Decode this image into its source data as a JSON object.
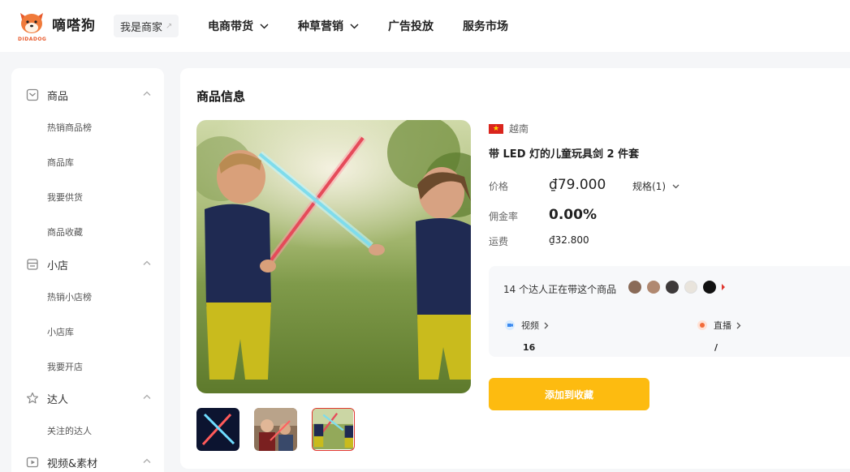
{
  "brand": {
    "name": "嘀嗒狗",
    "sub": "DIDADOG",
    "icon": "dog-logo-icon"
  },
  "merchant_switch": {
    "label": "我是商家",
    "icon": "arrow-up-right-icon"
  },
  "nav": [
    {
      "label": "电商带货",
      "has_dropdown": true
    },
    {
      "label": "种草营销",
      "has_dropdown": true
    },
    {
      "label": "广告投放",
      "has_dropdown": false
    },
    {
      "label": "服务市场",
      "has_dropdown": false
    }
  ],
  "sidebar": {
    "groups": [
      {
        "label": "商品",
        "icon": "product-icon",
        "expanded": true,
        "items": [
          "热销商品榜",
          "商品库",
          "我要供货",
          "商品收藏"
        ]
      },
      {
        "label": "小店",
        "icon": "shop-icon",
        "expanded": true,
        "items": [
          "热销小店榜",
          "小店库",
          "我要开店"
        ]
      },
      {
        "label": "达人",
        "icon": "star-person-icon",
        "expanded": true,
        "items": [
          "关注的达人"
        ]
      },
      {
        "label": "视频&素材",
        "icon": "video-icon",
        "expanded": true,
        "items": []
      }
    ]
  },
  "product": {
    "section_title": "商品信息",
    "country": "越南",
    "country_flag": "vietnam-flag-icon",
    "title": "带 LED 灯的儿童玩具剑 2 件套",
    "price_label": "价格",
    "price": "₫79.000",
    "spec_label": "规格(1)",
    "commission_label": "佣金率",
    "commission": "0.00%",
    "shipping_label": "运费",
    "shipping": "₫32.800",
    "thumbnails": 3,
    "active_thumbnail": 3
  },
  "influencers": {
    "summary": "14 个达人正在带这个商品",
    "avatar_colors": [
      "#8a6b58",
      "#b08870",
      "#3e3a3a",
      "#e9e4dc",
      "#111111"
    ],
    "video_label": "视频",
    "video_value": "16",
    "live_label": "直播",
    "live_value": "/"
  },
  "actions": {
    "add_to_favorites": "添加到收藏"
  },
  "colors": {
    "accent": "#fdbb10",
    "active_border": "#e0372f"
  }
}
